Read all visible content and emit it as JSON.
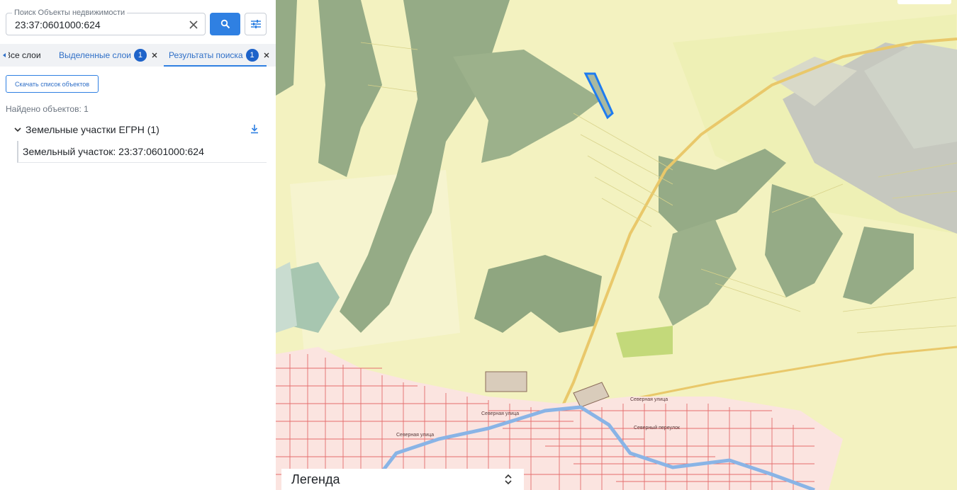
{
  "search": {
    "label": "Поиск Объекты недвижимости",
    "value": "23:37:0601000:624"
  },
  "tabs": [
    {
      "label": "Все слои"
    },
    {
      "label": "Выделенные слои",
      "count": "1"
    },
    {
      "label": "Результаты поиска",
      "count": "1"
    }
  ],
  "actions": {
    "download_list_label": "Скачать список объектов"
  },
  "results": {
    "found_text": "Найдено объектов: 1",
    "group_title": "Земельные участки ЕГРН (1)",
    "items": [
      {
        "label": "Земельный участок: 23:37:0601000:624"
      }
    ]
  },
  "map": {
    "street_labels": [
      "Северная улица",
      "Северная улица",
      "Северный переулок",
      "Северная улица"
    ]
  },
  "legend": {
    "title": "Легенда"
  },
  "colors": {
    "accent": "#2f80e2",
    "badge": "#1e63c9",
    "map_base": "#f3f2c0",
    "forest": "#95ab86",
    "field": "#e8ea98",
    "parcel_selected": "#1e7cf0",
    "urban": "#e46d6d",
    "river": "#89b4e6",
    "road": "#e9c86a"
  }
}
